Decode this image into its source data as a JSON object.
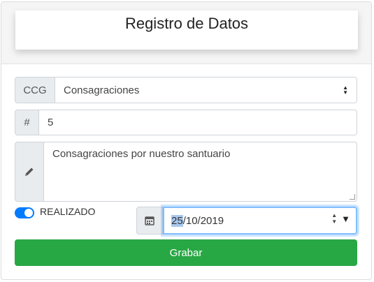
{
  "header": {
    "title": "Registro de Datos"
  },
  "form": {
    "category": {
      "addon": "CCG",
      "value": "Consagraciones"
    },
    "number": {
      "addon": "#",
      "value": "5"
    },
    "description": {
      "value": "Consagraciones por nuestro santuario"
    },
    "status": {
      "label": "REALIZADO",
      "checked": true
    },
    "date": {
      "day": "25",
      "rest": "/10/2019"
    },
    "submit_label": "Grabar"
  },
  "colors": {
    "accent": "#007bff",
    "success": "#28a745"
  }
}
